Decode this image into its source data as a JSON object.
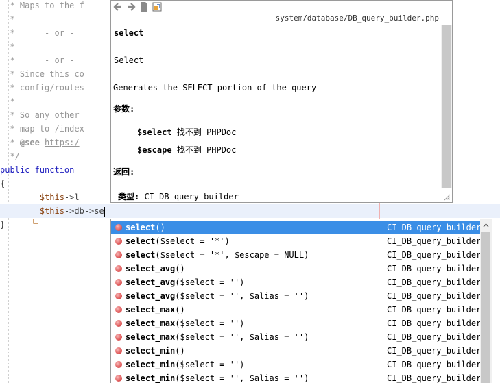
{
  "code": {
    "lines": [
      {
        "segments": [
          {
            "cls": "cmt",
            "text": "  * Maps to the f"
          }
        ]
      },
      {
        "segments": [
          {
            "cls": "cmt",
            "text": "  *"
          }
        ]
      },
      {
        "segments": [
          {
            "cls": "cmt",
            "text": "  *      - or -"
          }
        ]
      },
      {
        "segments": [
          {
            "cls": "cmt",
            "text": "  *"
          }
        ]
      },
      {
        "segments": [
          {
            "cls": "cmt",
            "text": "  *      - or -"
          }
        ]
      },
      {
        "segments": [
          {
            "cls": "cmt",
            "text": "  * Since this co"
          }
        ]
      },
      {
        "segments": [
          {
            "cls": "cmt",
            "text": "  * config/routes"
          }
        ]
      },
      {
        "segments": [
          {
            "cls": "cmt",
            "text": "  *"
          }
        ]
      },
      {
        "segments": [
          {
            "cls": "cmt",
            "text": "  * So any other"
          }
        ]
      },
      {
        "segments": [
          {
            "cls": "cmt",
            "text": "  * map to /index"
          }
        ]
      },
      {
        "segments": [
          {
            "cls": "cmt",
            "text": "  * "
          },
          {
            "cls": "cmt-tag",
            "text": "@see"
          },
          {
            "cls": "cmt",
            "text": " "
          },
          {
            "cls": "cmt-link",
            "text": "https:/"
          }
        ]
      },
      {
        "segments": [
          {
            "cls": "cmt",
            "text": "  */"
          }
        ]
      },
      {
        "segments": [
          {
            "cls": "kw",
            "text": "public function"
          }
        ]
      },
      {
        "segments": [
          {
            "cls": "",
            "text": "{"
          }
        ]
      },
      {
        "segments": [
          {
            "cls": "",
            "text": "        "
          },
          {
            "cls": "var",
            "text": "$this"
          },
          {
            "cls": "",
            "text": "->l"
          }
        ]
      },
      {
        "segments": [
          {
            "cls": "",
            "text": "        "
          },
          {
            "cls": "var",
            "text": "$this"
          },
          {
            "cls": "",
            "text": "->db->se"
          }
        ]
      },
      {
        "segments": [
          {
            "cls": "",
            "text": "}"
          }
        ]
      }
    ]
  },
  "doc": {
    "path": "system/database/DB_query_builder.php",
    "func_name": "select",
    "title": "Select",
    "description": "Generates the SELECT portion of the query",
    "params_label": "参数:",
    "param1_name": "$select",
    "param1_desc": "找不到 PHPDoc",
    "param2_name": "$escape",
    "param2_desc": "找不到 PHPDoc",
    "return_label": "返回:",
    "type_label": "类型:",
    "type_value": "CI_DB_query_builder"
  },
  "completion": {
    "items": [
      {
        "name": "select",
        "args": "()",
        "type": "CI_DB_query_builder",
        "selected": true
      },
      {
        "name": "select",
        "args": "($select = '*')",
        "type": "CI_DB_query_builder"
      },
      {
        "name": "select",
        "args": "($select = '*', $escape = NULL)",
        "type": "CI_DB_query_builder"
      },
      {
        "name": "select_avg",
        "args": "()",
        "type": "CI_DB_query_builder"
      },
      {
        "name": "select_avg",
        "args": "($select = '')",
        "type": "CI_DB_query_builder"
      },
      {
        "name": "select_avg",
        "args": "($select = '', $alias = '')",
        "type": "CI_DB_query_builder"
      },
      {
        "name": "select_max",
        "args": "()",
        "type": "CI_DB_query_builder"
      },
      {
        "name": "select_max",
        "args": "($select = '')",
        "type": "CI_DB_query_builder"
      },
      {
        "name": "select_max",
        "args": "($select = '', $alias = '')",
        "type": "CI_DB_query_builder"
      },
      {
        "name": "select_min",
        "args": "()",
        "type": "CI_DB_query_builder"
      },
      {
        "name": "select_min",
        "args": "($select = '')",
        "type": "CI_DB_query_builder"
      },
      {
        "name": "select_min",
        "args": "($select = '', $alias = '')",
        "type": "CI_DB_query_builder"
      }
    ]
  },
  "icons": {
    "back": "arrow-left-icon",
    "forward": "arrow-right-icon",
    "source": "source-file-icon",
    "external": "open-in-browser-icon",
    "method": "method-icon"
  },
  "colors": {
    "selection": "#3a8ee6",
    "current_line": "#eaf0fb",
    "comment": "#969696",
    "keyword": "#1f1fbf"
  }
}
